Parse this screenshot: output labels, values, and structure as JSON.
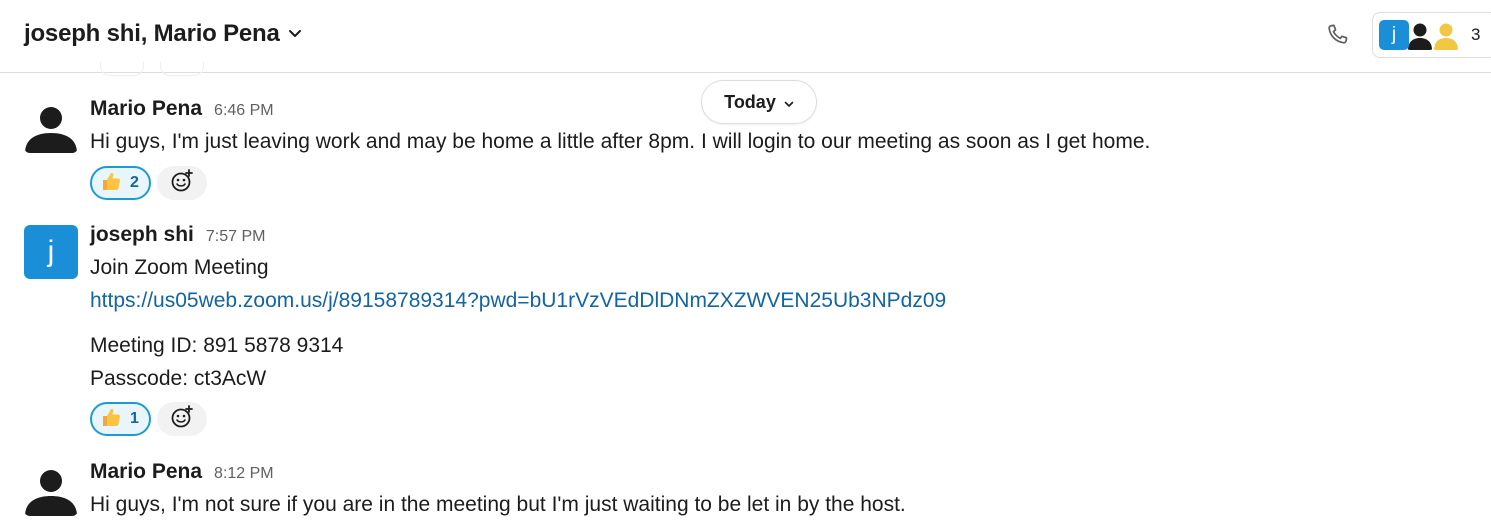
{
  "header": {
    "title": "joseph shi, Mario Pena",
    "member_initial": "j",
    "member_count": "3"
  },
  "date_divider": {
    "label": "Today"
  },
  "messages": [
    {
      "author": "Mario Pena",
      "time": "6:46 PM",
      "lines": [
        "Hi guys, I'm just leaving work and may be home a little after 8pm. I will login to our meeting as soon as I get home."
      ],
      "reaction": {
        "emoji": "thumbs-up",
        "count": "2"
      }
    },
    {
      "author": "joseph shi",
      "avatar_initial": "j",
      "time": "7:57 PM",
      "lines": [
        "Join Zoom Meeting",
        "https://us05web.zoom.us/j/89158789314?pwd=bU1rVzVEdDlDNmZXZWVEN25Ub3NPdz09",
        "Meeting ID: 891 5878 9314",
        "Passcode: ct3AcW"
      ],
      "reaction": {
        "emoji": "thumbs-up",
        "count": "1"
      }
    },
    {
      "author": "Mario Pena",
      "time": "8:12 PM",
      "lines": [
        "Hi guys, I'm not sure if you are in the meeting but I'm just waiting to be let in by the host."
      ]
    }
  ],
  "colors": {
    "accent_blue": "#1a8fd8",
    "link": "#1264a3",
    "reaction_border": "#1d9bd1",
    "reaction_bg": "#e8f5fa",
    "member_yellow": "#f2c744"
  },
  "icons": [
    "chevron-down-icon",
    "phone-icon",
    "person-avatar-icon",
    "thumbs-up-icon",
    "add-emoji-icon"
  ]
}
